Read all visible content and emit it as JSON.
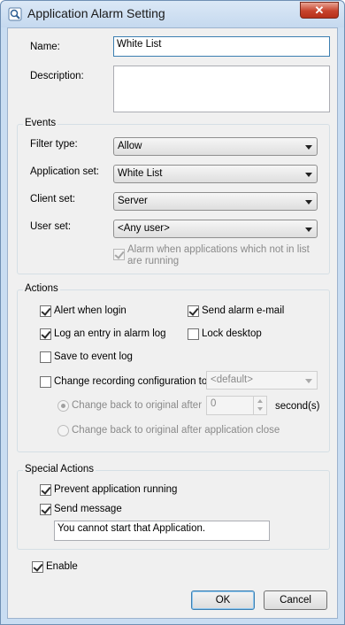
{
  "window": {
    "title": "Application Alarm Setting",
    "close_label": "✕"
  },
  "name": {
    "label": "Name:",
    "value": "White List"
  },
  "description": {
    "label": "Description:",
    "value": ""
  },
  "events": {
    "group_label": "Events",
    "filter_type": {
      "label": "Filter type:",
      "value": "Allow"
    },
    "application_set": {
      "label": "Application set:",
      "value": "White List"
    },
    "client_set": {
      "label": "Client set:",
      "value": "Server"
    },
    "user_set": {
      "label": "User set:",
      "value": "<Any user>"
    },
    "alarm_not_in_list": {
      "label": "Alarm when applications which not in list are running",
      "checked": true
    }
  },
  "actions": {
    "group_label": "Actions",
    "alert_when_login": {
      "label": "Alert when login",
      "checked": true
    },
    "send_alarm_email": {
      "label": "Send alarm e-mail",
      "checked": true
    },
    "log_entry": {
      "label": "Log an entry in alarm log",
      "checked": true
    },
    "lock_desktop": {
      "label": "Lock desktop",
      "checked": false
    },
    "save_event_log": {
      "label": "Save to event log",
      "checked": false
    },
    "change_recording": {
      "label": "Change recording configuration to",
      "checked": false,
      "value": "<default>"
    },
    "change_back_after": {
      "label": "Change back to original after",
      "value": "0",
      "unit": "second(s)",
      "selected": true
    },
    "change_back_close": {
      "label": "Change back to original after application close",
      "selected": false
    }
  },
  "special_actions": {
    "group_label": "Special Actions",
    "prevent_running": {
      "label": "Prevent application running",
      "checked": true
    },
    "send_message": {
      "label": "Send message",
      "checked": true,
      "message": "You cannot start that Application."
    }
  },
  "enable": {
    "label": "Enable",
    "checked": true
  },
  "buttons": {
    "ok": "OK",
    "cancel": "Cancel"
  },
  "colors": {
    "accent": "#3c7fb1",
    "close": "#c7432c",
    "titlebar": "#c9ddf2"
  }
}
